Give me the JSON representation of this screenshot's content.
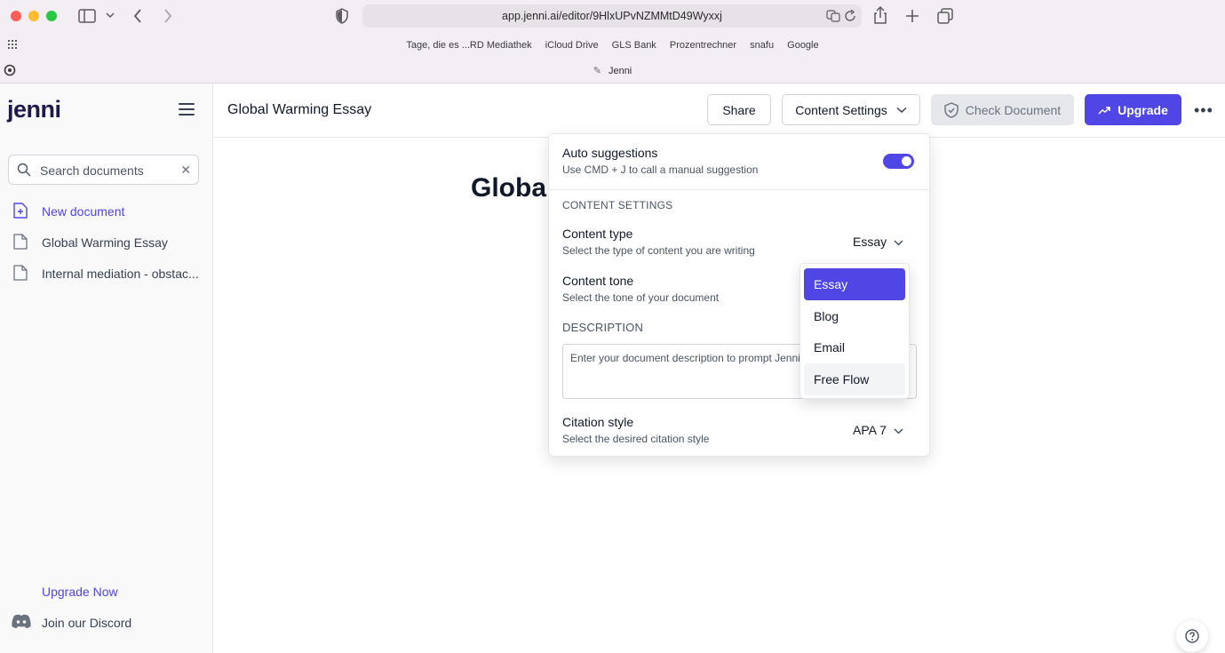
{
  "browser": {
    "url": "app.jenni.ai/editor/9HlxUPvNZMMtD49Wyxxj",
    "bookmarks": [
      "Tage, die es ...RD Mediathek",
      "iCloud Drive",
      "GLS Bank",
      "Prozentrechner",
      "snafu",
      "Google"
    ],
    "tab_title": "Jenni"
  },
  "sidebar": {
    "logo": "jenni",
    "search_placeholder": "Search documents",
    "items": [
      {
        "label": "New document"
      },
      {
        "label": "Global Warming Essay"
      },
      {
        "label": "Internal mediation - obstac..."
      }
    ],
    "upgrade_label": "Upgrade Now",
    "discord_label": "Join our Discord"
  },
  "topbar": {
    "doc_title": "Global Warming Essay",
    "share_label": "Share",
    "content_settings_label": "Content Settings",
    "check_label": "Check Document",
    "upgrade_label": "Upgrade"
  },
  "editor": {
    "heading_partial": "Globa"
  },
  "settings": {
    "auto_title": "Auto suggestions",
    "auto_sub": "Use CMD + J to call a manual suggestion",
    "auto_enabled": true,
    "section_label": "CONTENT SETTINGS",
    "content_type_title": "Content type",
    "content_type_sub": "Select the type of content you are writing",
    "content_type_value": "Essay",
    "content_tone_title": "Content tone",
    "content_tone_sub": "Select the tone of your document",
    "description_label": "DESCRIPTION",
    "description_placeholder": "Enter your document description to prompt Jenni",
    "citation_title": "Citation style",
    "citation_sub": "Select the desired citation style",
    "citation_value": "APA 7"
  },
  "dropdown": {
    "options": [
      "Essay",
      "Blog",
      "Email",
      "Free Flow"
    ],
    "selected": "Essay"
  },
  "colors": {
    "accent": "#4f46e5"
  }
}
